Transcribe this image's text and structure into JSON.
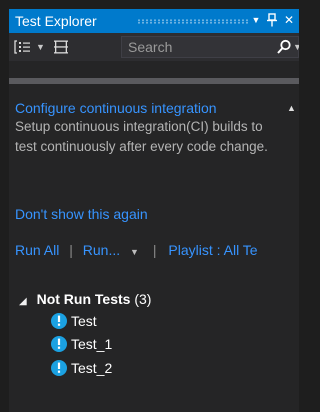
{
  "window": {
    "title": "Test Explorer",
    "dropdown_glyph": "▼",
    "pin_glyph": "ᛘ",
    "close_glyph": "✕"
  },
  "toolbar": {
    "group_by_icon": "group-by-icon",
    "playlist_icon": "playlist-icon",
    "caret_glyph": "▼",
    "search": {
      "value": "",
      "placeholder": "Search",
      "icon": "search-icon",
      "caret_glyph": "▼"
    }
  },
  "banner": {
    "title": "Configure continuous integration",
    "collapse_glyph": "▲",
    "body": "Setup continuous integration(CI) builds to test continuously after every code change.",
    "dismiss_link": "Don't show this again"
  },
  "actions": {
    "run_all": "Run All",
    "separator": "|",
    "run": "Run...",
    "run_dropdown_glyph": "▼",
    "playlist": "Playlist : All Te"
  },
  "tests": {
    "expand_glyph": "◢",
    "group_name": "Not Run Tests",
    "group_count": "(3)",
    "status_icon": "info-icon",
    "items": [
      {
        "name": "Test"
      },
      {
        "name": "Test_1"
      },
      {
        "name": "Test_2"
      }
    ]
  },
  "colors": {
    "accent": "#007acc",
    "link": "#3794ff",
    "background": "#252526",
    "toolbar": "#2d2d30",
    "status_icon": "#1ba1e2"
  }
}
